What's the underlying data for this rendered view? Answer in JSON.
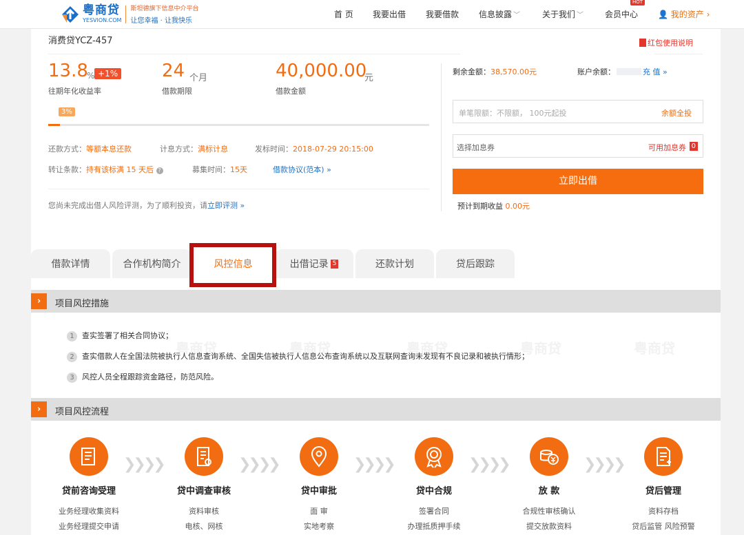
{
  "header": {
    "brand_cn": "粤商贷",
    "brand_en": "YESVION.COM",
    "slogan_top": "斯坦德旗下信息中介平台",
    "slogan_bottom": "让您幸福 · 让我快乐",
    "nav": [
      {
        "label": "首 页"
      },
      {
        "label": "我要出借"
      },
      {
        "label": "我要借款"
      },
      {
        "label": "信息披露"
      },
      {
        "label": "关于我们"
      },
      {
        "label": "会员中心"
      },
      {
        "label": "我的资产"
      }
    ],
    "hot_badge": "HOT"
  },
  "loan": {
    "name": "消费贷YCZ-457",
    "redpack_link": "红包使用说明",
    "rate": "13.8",
    "rate_unit": "%",
    "rate_bonus": "+1%",
    "rate_label": "往期年化收益率",
    "term": "24",
    "term_unit": "个月",
    "term_label": "借款期限",
    "amount": "40,000.00",
    "amount_unit": "元",
    "amount_label": "借款金额",
    "progress_label": "3%",
    "progress": 0.03,
    "repay_label": "还款方式：",
    "repay_value": "等额本息还款",
    "interest_label": "计息方式：",
    "interest_value": "满标计息",
    "publish_label": "发标时间：",
    "publish_value": "2018-07-29 20:15:00",
    "transfer_label": "转让条款：",
    "transfer_value": "持有该标满 15 天后",
    "raise_label": "募集时间：",
    "raise_value": "15天",
    "agreement_link": "借款协议(范本) »",
    "risk_notice": "您尚未完成出借人风险评测，为了顺利投资，请",
    "risk_link": "立即评测 »"
  },
  "invest": {
    "remain_label": "剩余金额：",
    "remain_value": "38,570.00元",
    "balance_label": "账户余额：",
    "recharge_link": "充 值 »",
    "amount_placeholder": "单笔限额：不限额， 100元起投",
    "all_in": "余额全投",
    "coupon_placeholder": "选择加息券",
    "coupon_available": "可用加息券",
    "coupon_count": "0",
    "submit": "立即出借",
    "expected_label": "预计到期收益",
    "expected_value": "0.00元"
  },
  "tabs": [
    {
      "label": "借款详情"
    },
    {
      "label": "合作机构简介"
    },
    {
      "label": "风控信息"
    },
    {
      "label": "出借记录",
      "badge": "5"
    },
    {
      "label": "还款计划"
    },
    {
      "label": "贷后跟踪"
    }
  ],
  "risk_measures": {
    "title": "项目风控措施",
    "items": [
      {
        "num": "1",
        "text": "查实签署了相关合同协议；"
      },
      {
        "num": "2",
        "text": "查实借款人在全国法院被执行人信息查询系统、全国失信被执行人信息公布查询系统以及互联网查询未发现有不良记录和被执行情形；"
      },
      {
        "num": "3",
        "text": "风控人员全程跟踪资金路径，防范风险。"
      }
    ]
  },
  "risk_process": {
    "title": "项目风控流程",
    "steps": [
      {
        "title": "贷前咨询受理",
        "icon": "scroll-icon",
        "lines": [
          "业务经理收集资料",
          "业务经理提交申请"
        ]
      },
      {
        "title": "贷中调查审核",
        "icon": "document-review-icon",
        "lines": [
          "资料审核",
          "电核、网核"
        ]
      },
      {
        "title": "贷中审批",
        "icon": "location-pin-icon",
        "lines": [
          "面 审",
          "实地考察"
        ]
      },
      {
        "title": "贷中合规",
        "icon": "medal-icon",
        "lines": [
          "签署合同",
          "办理抵质押手续"
        ]
      },
      {
        "title": "放 款",
        "icon": "coins-icon",
        "lines": [
          "合规性审核确认",
          "提交放款资料"
        ]
      },
      {
        "title": "贷后管理",
        "icon": "document-add-icon",
        "lines": [
          "资料存档",
          "贷后监管 风险预警"
        ]
      }
    ]
  },
  "colors": {
    "accent": "#f26d12",
    "link": "#1f72c4",
    "highlight": "#b80f0f"
  }
}
